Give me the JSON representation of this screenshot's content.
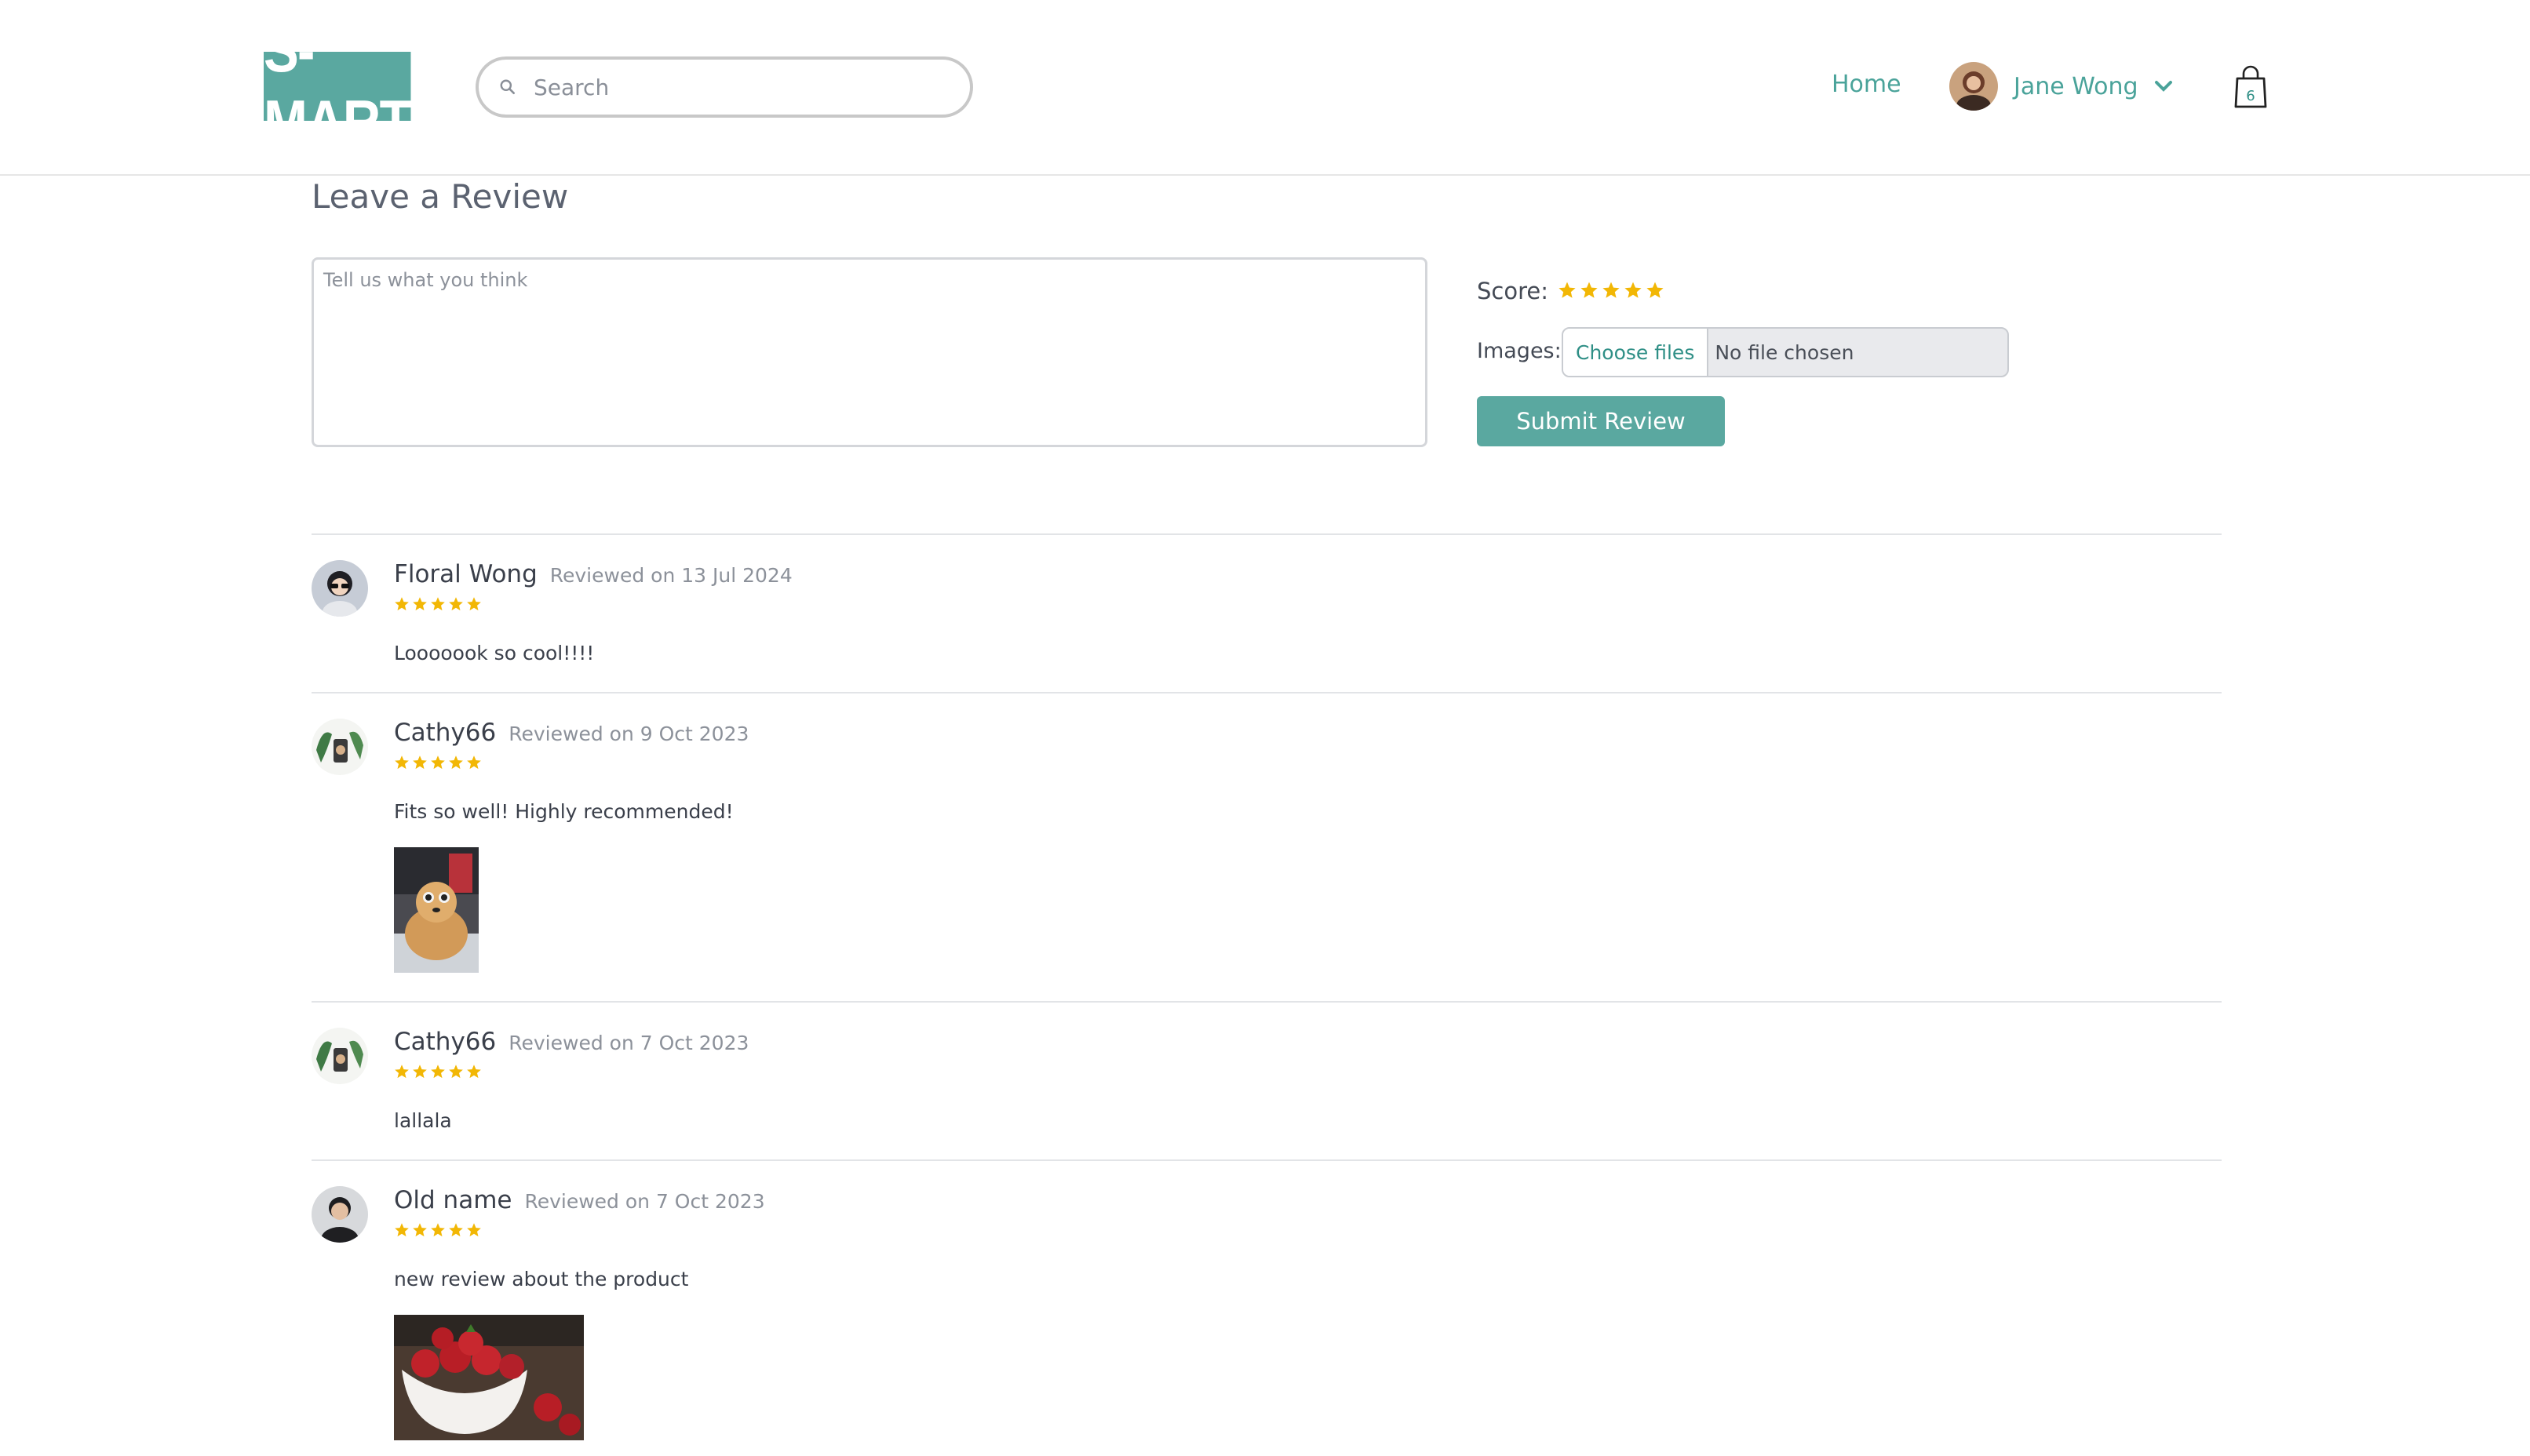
{
  "header": {
    "logo_text": "S-MART",
    "search_placeholder": "Search",
    "nav_home": "Home",
    "user_name": "Jane Wong",
    "cart_count": "6"
  },
  "form": {
    "title": "Leave a Review",
    "textarea_placeholder": "Tell us what you think",
    "score_label": "Score:",
    "score_value": 5,
    "images_label": "Images:",
    "choose_files": "Choose files",
    "no_file": "No file chosen",
    "submit_label": "Submit Review"
  },
  "colors": {
    "accent": "#5aa8a0",
    "star": "#f2b705"
  },
  "reviews": [
    {
      "name": "Floral Wong",
      "date": "Reviewed on 13 Jul 2024",
      "rating": 5,
      "text": "Looooook so cool!!!!",
      "image": null
    },
    {
      "name": "Cathy66",
      "date": "Reviewed on 9 Oct 2023",
      "rating": 5,
      "text": "Fits so well! Highly recommended!",
      "image": "dog-photo"
    },
    {
      "name": "Cathy66",
      "date": "Reviewed on 7 Oct 2023",
      "rating": 5,
      "text": "lallala",
      "image": null
    },
    {
      "name": "Old name",
      "date": "Reviewed on 7 Oct 2023",
      "rating": 5,
      "text": "new review about the product",
      "image": "strawberries-photo"
    }
  ]
}
